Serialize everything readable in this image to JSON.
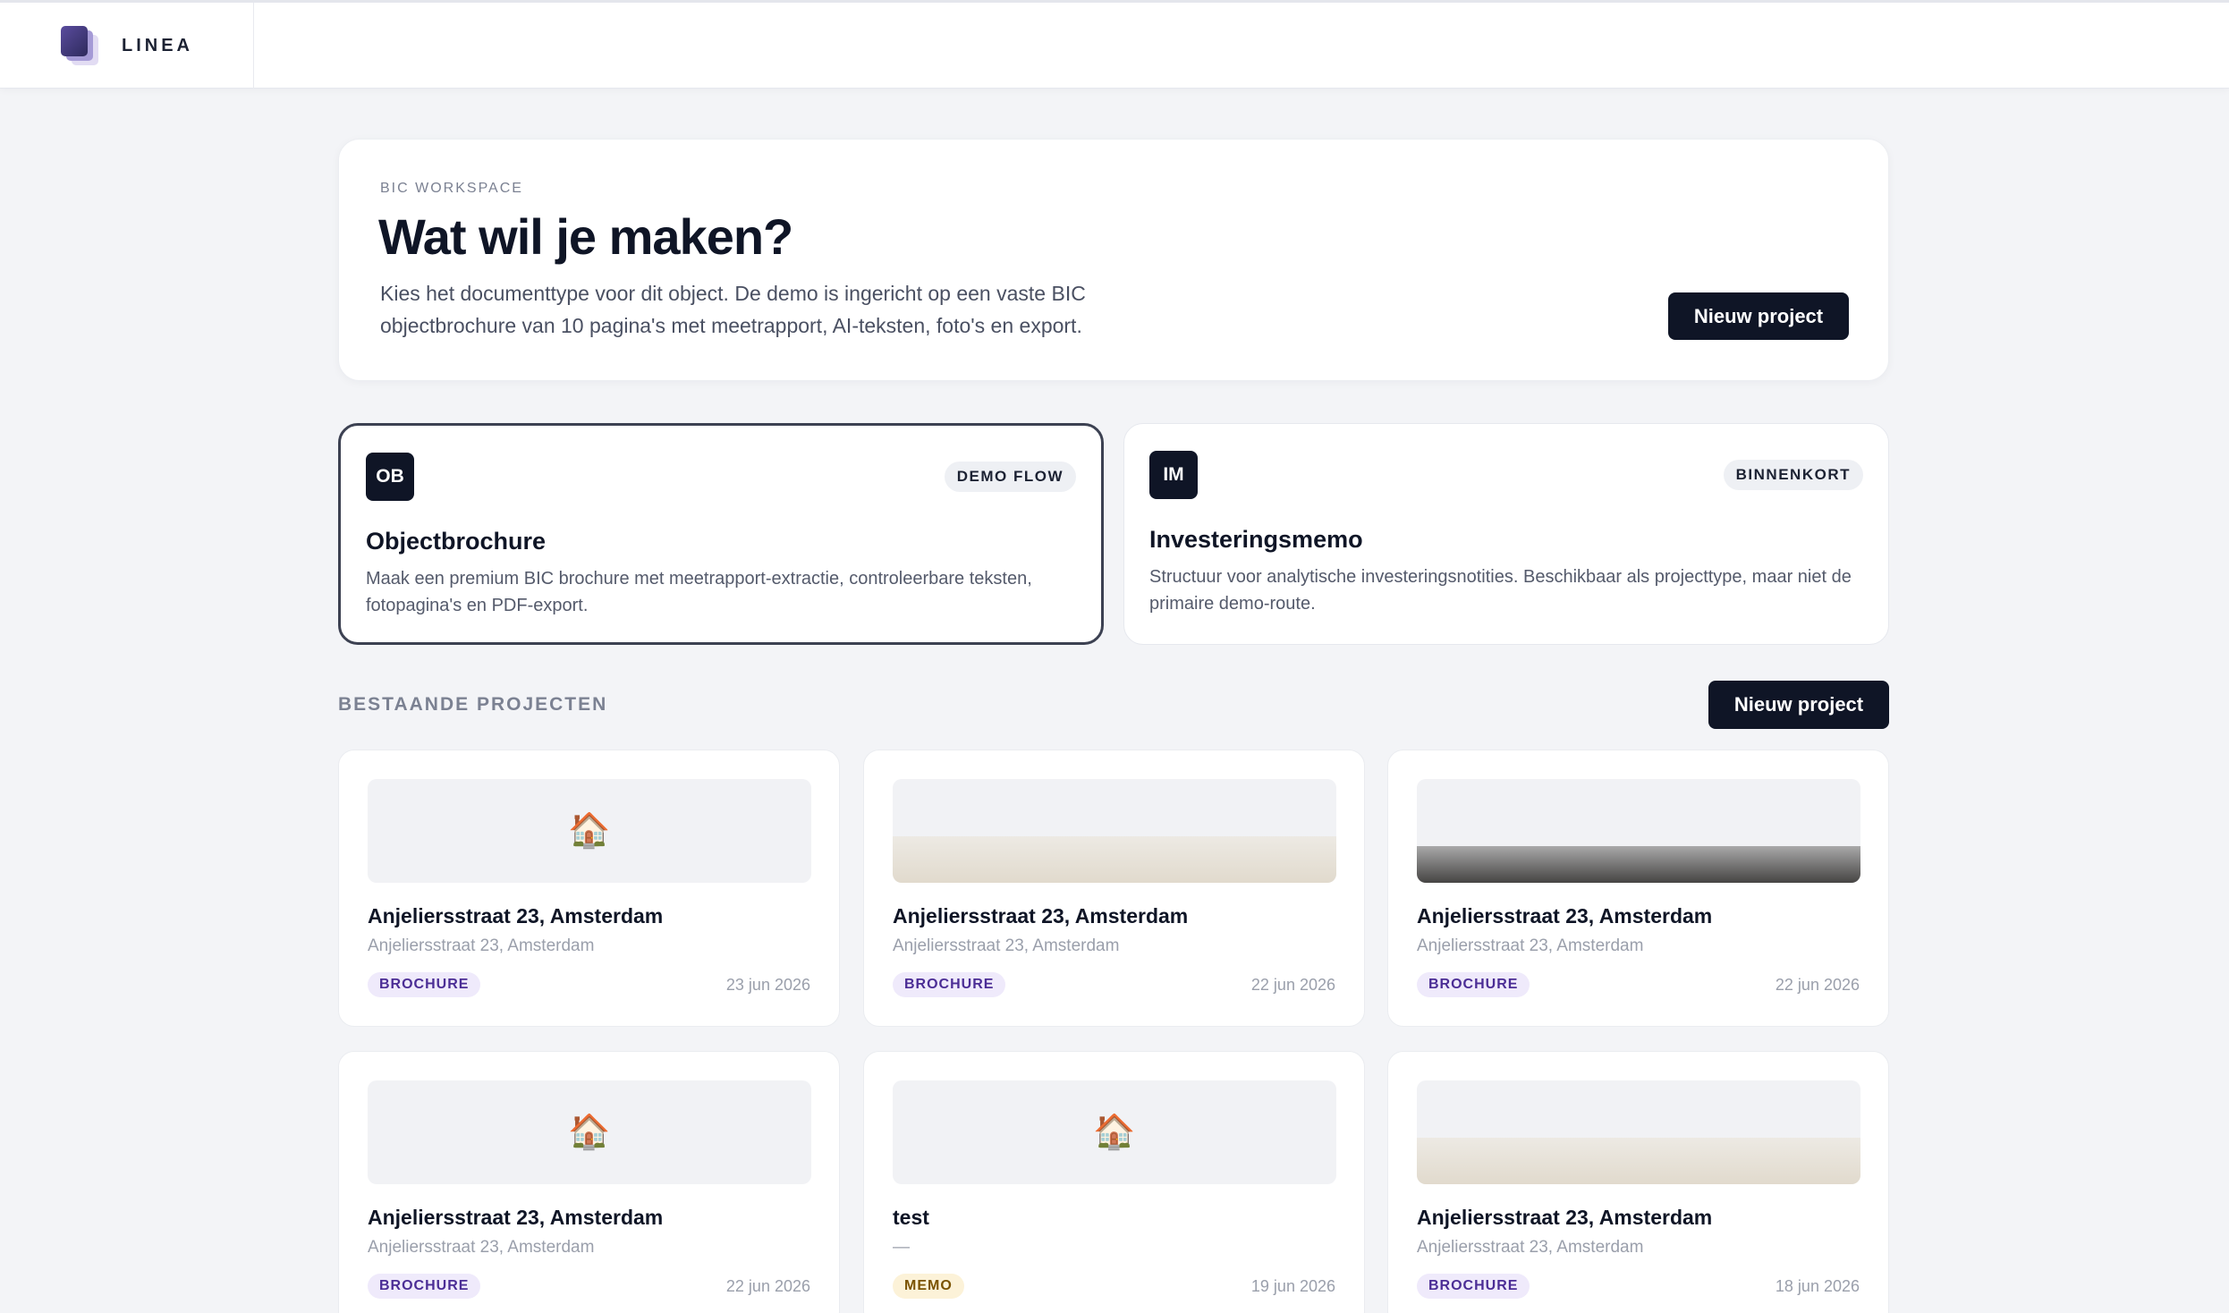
{
  "brand": {
    "name": "LINEA"
  },
  "hero": {
    "eyebrow": "BIC WORKSPACE",
    "title": "Wat wil je maken?",
    "description": "Kies het documenttype voor dit object. De demo is ingericht op een vaste BIC objectbrochure van 10 pagina's met meetrapport, AI-teksten, foto's en export.",
    "button": "Nieuw project"
  },
  "types": [
    {
      "abbr": "OB",
      "badge": "DEMO FLOW",
      "title": "Objectbrochure",
      "description": "Maak een premium BIC brochure met meetrapport-extractie, controleerbare teksten, fotopagina's en PDF-export.",
      "selected": true
    },
    {
      "abbr": "IM",
      "badge": "BINNENKORT",
      "title": "Investeringsmemo",
      "description": "Structuur voor analytische investeringsnotities. Beschikbaar als projecttype, maar niet de primaire demo-route.",
      "selected": false
    }
  ],
  "projects_section": {
    "title": "BESTAANDE PROJECTEN",
    "button": "Nieuw project"
  },
  "projects": [
    {
      "title": "Anjeliersstraat 23, Amsterdam",
      "subtitle": "Anjeliersstraat 23, Amsterdam",
      "badge": "BROCHURE",
      "date": "23 jun 2026",
      "thumb": "placeholder-house-icon"
    },
    {
      "title": "Anjeliersstraat 23, Amsterdam",
      "subtitle": "Anjeliersstraat 23, Amsterdam",
      "badge": "BROCHURE",
      "date": "22 jun 2026",
      "thumb": "interior-photo"
    },
    {
      "title": "Anjeliersstraat 23, Amsterdam",
      "subtitle": "Anjeliersstraat 23, Amsterdam",
      "badge": "BROCHURE",
      "date": "22 jun 2026",
      "thumb": "interior-photo"
    },
    {
      "title": "Anjeliersstraat 23, Amsterdam",
      "subtitle": "Anjeliersstraat 23, Amsterdam",
      "badge": "BROCHURE",
      "date": "22 jun 2026",
      "thumb": "placeholder-house-icon"
    },
    {
      "title": "test",
      "subtitle": "—",
      "badge": "MEMO",
      "date": "19 jun 2026",
      "thumb": "placeholder-house-icon"
    },
    {
      "title": "Anjeliersstraat 23, Amsterdam",
      "subtitle": "Anjeliersstraat 23, Amsterdam",
      "badge": "BROCHURE",
      "date": "18 jun 2026",
      "thumb": "interior-photo"
    }
  ],
  "icons": {
    "house": "🏠"
  },
  "colors": {
    "primary": "#0f1526",
    "brochure_badge": "#4b2d95",
    "memo_badge": "#7a5200"
  }
}
